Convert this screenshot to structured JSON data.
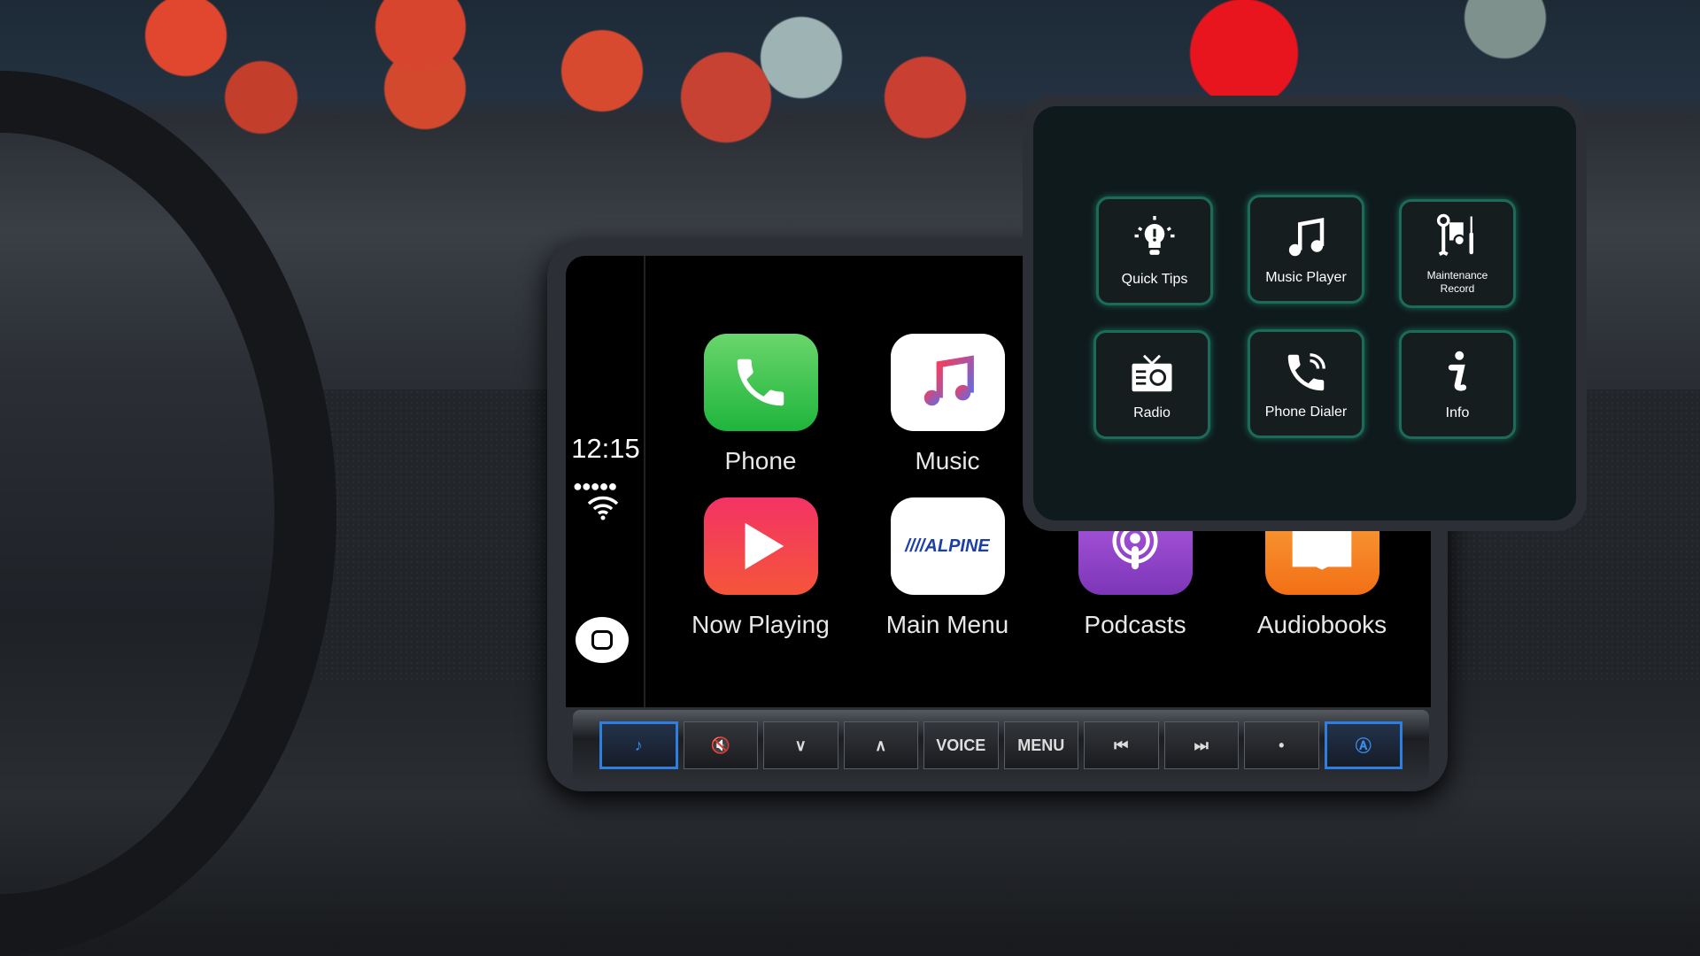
{
  "carplay": {
    "time": "12:15",
    "signal": "●●●●●",
    "apps": [
      {
        "label": "Phone",
        "icon": "phone-icon",
        "color": "#4cd964"
      },
      {
        "label": "Music",
        "icon": "music-note-icon",
        "color": "#ffffff"
      },
      {
        "label": "Now Playing",
        "icon": "play-icon",
        "color": "#f23b4f"
      },
      {
        "label": "Main Menu",
        "icon": "alpine-logo-icon",
        "logo": "////ALPINE",
        "color": "#ffffff"
      },
      {
        "label": "Podcasts",
        "icon": "podcast-icon",
        "color": "#8e44c5"
      },
      {
        "label": "Audiobooks",
        "icon": "book-icon",
        "color": "#f58a1f"
      }
    ]
  },
  "hardware_buttons": [
    {
      "label": "♪",
      "icon": "music-note-icon"
    },
    {
      "label": "🔇",
      "icon": "mute-icon"
    },
    {
      "label": "∨",
      "icon": "volume-down-icon"
    },
    {
      "label": "∧",
      "icon": "volume-up-icon"
    },
    {
      "label": "VOICE"
    },
    {
      "label": "MENU"
    },
    {
      "label": "⏮",
      "icon": "previous-track-icon"
    },
    {
      "label": "⏭",
      "icon": "next-track-icon"
    },
    {
      "label": "•",
      "icon": "knob-icon"
    },
    {
      "label": "Ⓐ",
      "icon": "navigation-icon"
    }
  ],
  "menu": {
    "accent": "#1c6b58",
    "items": [
      {
        "label": "Quick Tips",
        "icon": "lightbulb-icon"
      },
      {
        "label": "Music Player",
        "icon": "music-note-icon"
      },
      {
        "label": "Maintenance Record",
        "icon": "maintenance-tools-icon"
      },
      {
        "label": "Radio",
        "icon": "radio-icon"
      },
      {
        "label": "Phone Dialer",
        "icon": "phone-ringing-icon"
      },
      {
        "label": "Info",
        "icon": "info-icon"
      }
    ]
  }
}
